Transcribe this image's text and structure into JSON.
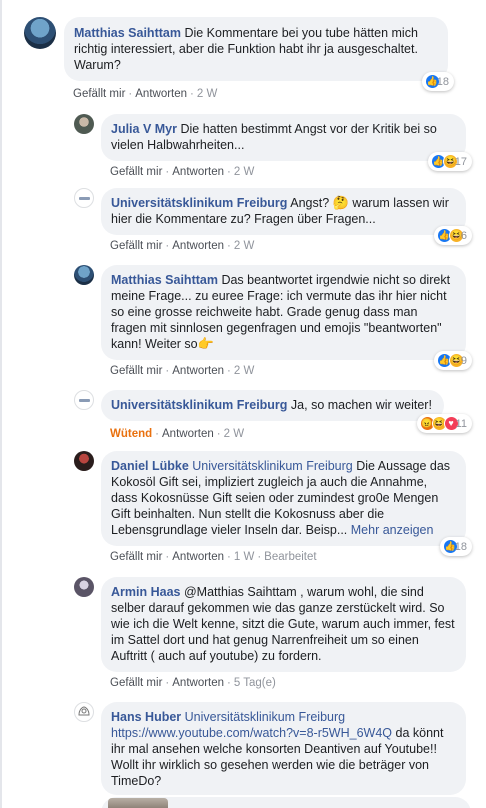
{
  "comments": [
    {
      "author": "Matthias Saihttam",
      "text": "Die Kommentare bei you tube hätten mich richtig interessiert, aber die Funktion habt ihr ja ausgeschaltet. Warum?",
      "like": "Gefällt mir",
      "reply": "Antworten",
      "time": "2 W",
      "reaction_count": "18",
      "reactions": [
        "like"
      ]
    },
    {
      "author": "Julia V Myr",
      "text": "Die hatten bestimmt Angst vor der Kritik bei so vielen Halbwahrheiten...",
      "like": "Gefällt mir",
      "reply": "Antworten",
      "time": "2 W",
      "reaction_count": "17",
      "reactions": [
        "like",
        "haha"
      ]
    },
    {
      "author": "Universitätsklinikum Freiburg",
      "text_before": "Angst?",
      "emoji": "🤔",
      "text_after": "warum lassen wir hier die Kommentare zu? Fragen über Fragen...",
      "like": "Gefällt mir",
      "reply": "Antworten",
      "time": "2 W",
      "reaction_count": "6",
      "reactions": [
        "like",
        "haha"
      ]
    },
    {
      "author": "Matthias Saihttam",
      "text": "Das beantwortet irgendwie nicht so direkt meine Frage... zu euree Frage: ich vermute das ihr hier nicht so eine grosse reichweite habt. Grade genug dass man fragen mit sinnlosen gegenfragen und emojis \"beantworten\" kann! Weiter so",
      "emoji": "👉",
      "like": "Gefällt mir",
      "reply": "Antworten",
      "time": "2 W",
      "reaction_count": "9",
      "reactions": [
        "like",
        "haha"
      ]
    },
    {
      "author": "Universitätsklinikum Freiburg",
      "text": "Ja, so machen wir weiter!",
      "like": "Wütend",
      "reply": "Antworten",
      "time": "2 W",
      "reaction_count": "11",
      "reactions": [
        "angry",
        "haha",
        "love"
      ]
    },
    {
      "author": "Daniel Lübke",
      "mention": "Universitätsklinikum Freiburg",
      "text": "Die Aussage das Kokosöl Gift sei, impliziert zugleich ja auch die Annahme, dass Kokosnüsse Gift seien oder zumindest gro0e Mengen Gift beinhalten. Nun stellt die Kokosnuss aber die Lebensgrundlage vieler Inseln dar. Beisp...",
      "more": "Mehr anzeigen",
      "like": "Gefällt mir",
      "reply": "Antworten",
      "time": "1 W",
      "edited": "Bearbeitet",
      "reaction_count": "18",
      "reactions": [
        "like"
      ]
    },
    {
      "author": "Armin Haas",
      "text": "@Matthias Saihttam , warum wohl, die sind selber darauf gekommen wie das ganze zerstückelt wird. So wie ich die Welt kenne, sitzt die Gute, warum auch immer, fest im Sattel dort und hat genug Narrenfreiheit um so einen Auftritt ( auch auf youtube) zu fordern.",
      "like": "Gefällt mir",
      "reply": "Antworten",
      "time": "5 Tag(e)"
    },
    {
      "author": "Hans Huber",
      "mention": "Universitätsklinikum Freiburg",
      "link": "https://www.youtube.com/watch?v=8-r5WH_6W4Q",
      "text": "da könnt ihr mal ansehen welche konsorten Deantiven auf Youtube!! Wollt ihr wirklich so gesehen werden wie die beträger von TimeDo?"
    }
  ],
  "colors": {
    "link": "#385898",
    "bubble": "#f0f2f5",
    "like_reaction": "#1877f2",
    "angry_label": "#e9710f"
  },
  "icons": [
    "like-reaction-icon",
    "haha-reaction-icon",
    "angry-reaction-icon",
    "love-reaction-icon"
  ]
}
